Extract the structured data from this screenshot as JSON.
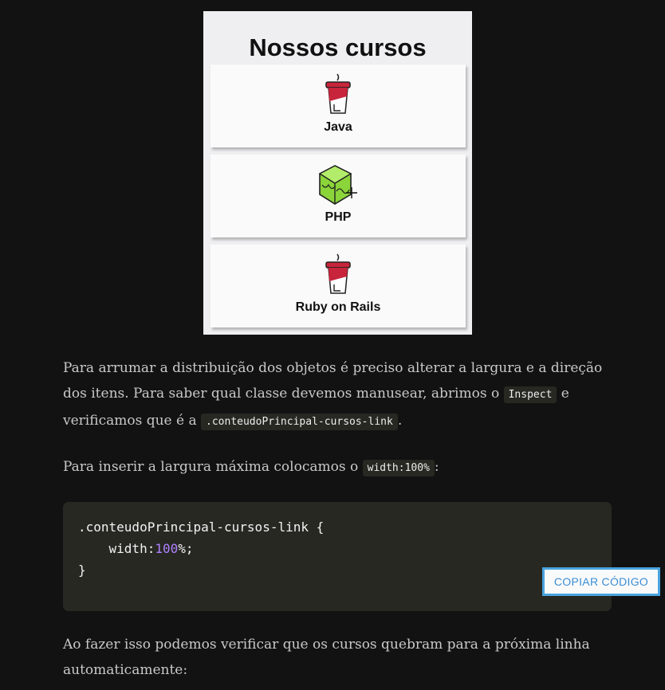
{
  "figure": {
    "title": "Nossos cursos",
    "cards": [
      {
        "label": "Java",
        "icon": "cup-icon"
      },
      {
        "label": "PHP",
        "icon": "cube-icon"
      },
      {
        "label": "Ruby on Rails",
        "icon": "cup-icon"
      }
    ]
  },
  "article": {
    "p1": {
      "t1": "Para arrumar a distribuição dos objetos é preciso alterar a largura e a direção dos itens. Para saber qual classe devemos manusear, abrimos o ",
      "code1": "Inspect",
      "t2": " e verificamos que é a ",
      "code2": ".conteudoPrincipal-cursos-link",
      "t3": "."
    },
    "p2": {
      "t1": "Para inserir a largura máxima colocamos o ",
      "code1": "width:100%",
      "t2": ":"
    },
    "code": {
      "line1": ".conteudoPrincipal-cursos-link {",
      "line2_prop": "    width:",
      "line2_num": "100",
      "line2_end": "%;",
      "line3": "}",
      "copy_label": "COPIAR CÓDIGO"
    },
    "p3": "Ao fazer isso podemos verificar que os cursos quebram para a próxima linha automaticamente:"
  },
  "colors": {
    "background": "#121212",
    "code_bg": "#272822",
    "number": "#ae81ff",
    "button_border": "#4aa3df"
  }
}
